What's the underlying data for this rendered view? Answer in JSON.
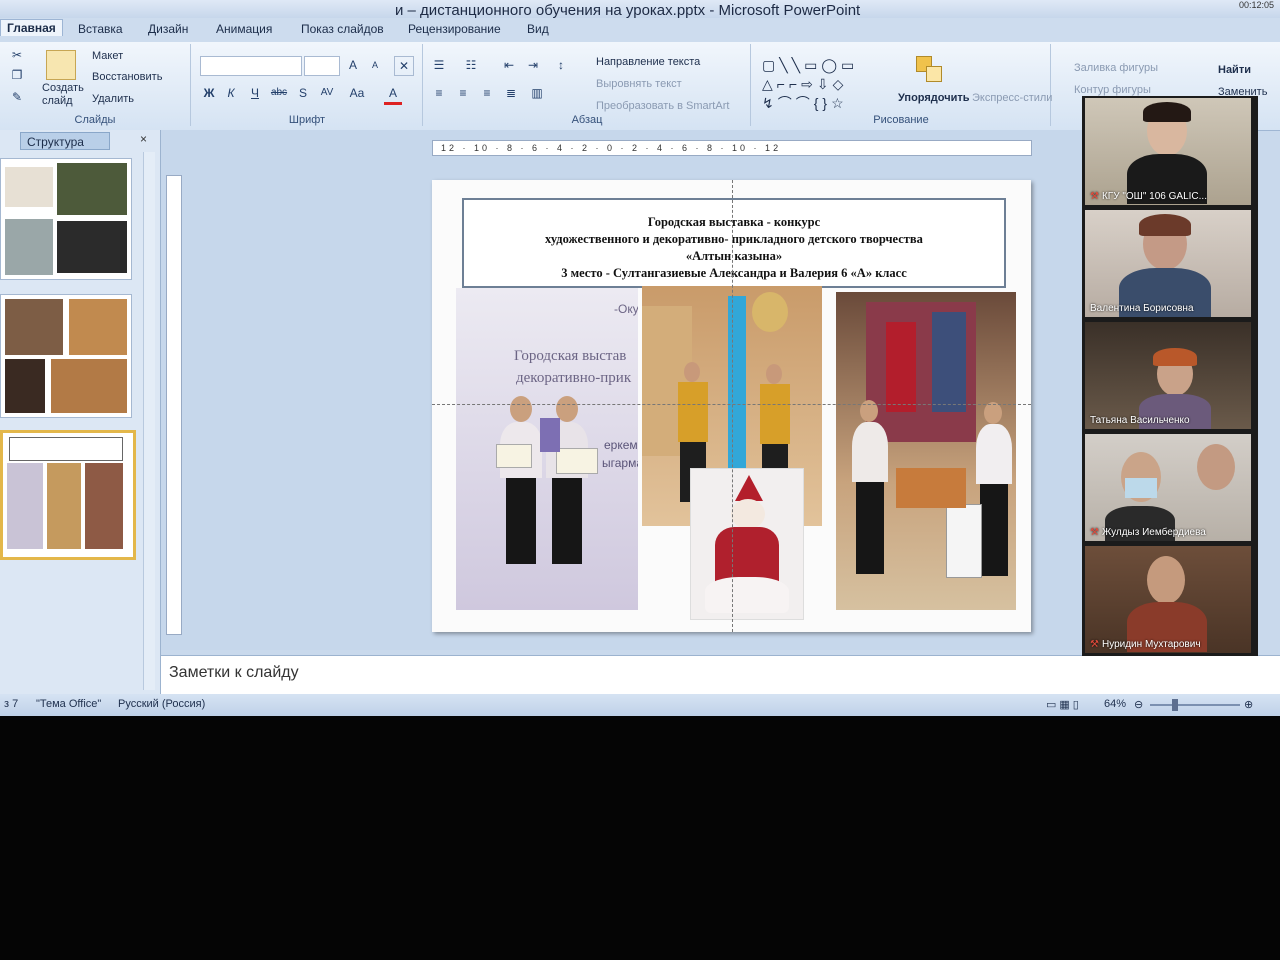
{
  "window": {
    "title": "и – дистанционного обучения на уроках.pptx - Microsoft PowerPoint",
    "clock": "00:12:05"
  },
  "tabs": [
    {
      "label": "Главная"
    },
    {
      "label": "Вставка"
    },
    {
      "label": "Дизайн"
    },
    {
      "label": "Анимация"
    },
    {
      "label": "Показ слайдов"
    },
    {
      "label": "Рецензирование"
    },
    {
      "label": "Вид"
    }
  ],
  "ribbon": {
    "slides_group": {
      "label": "Слайды",
      "create_slide": "Создать слайд",
      "layout": "Макет",
      "reset": "Восстановить",
      "delete": "Удалить"
    },
    "font_group": {
      "label": "Шрифт",
      "bold": "Ж",
      "italic": "К",
      "underline": "Ч",
      "strike": "abc",
      "shadow": "S",
      "spacing": "AV",
      "case": "Aa",
      "grow": "A",
      "shrink": "A",
      "color": "A"
    },
    "paragraph_group": {
      "label": "Абзац",
      "text_direction": "Направление текста",
      "align_text": "Выровнять текст",
      "smartart": "Преобразовать в SmartArt"
    },
    "drawing_group": {
      "label": "Рисование",
      "arrange": "Упорядочить",
      "quick_styles": "Экспресс-стили",
      "shape_fill": "Заливка фигуры",
      "shape_outline": "Контур фигуры"
    },
    "editing_group": {
      "find": "Найти",
      "replace": "Заменить"
    }
  },
  "left_pane": {
    "tab": "Структура",
    "close": "×"
  },
  "ruler": {
    "h_ticks": "12 · 10 · 8 · 6 · 4 · 2 · 0 · 2 · 4 · 6 · 8 · 10 · 12"
  },
  "slide": {
    "title_line1": "Городская   выставка - конкурс",
    "title_line2": "художественного и декоративно- прикладного   детского творчества",
    "title_line3": "«Алтын казына»",
    "title_line4": "3 место - Султангазиевые Александра и Валерия  6 «А» класс",
    "banner_text_1": "Городская выстав",
    "banner_text_2": "декоративно-прик",
    "banner_text_3": "-Оку",
    "banner_text_4": "ыгарма",
    "banner_text_5": "еркеме"
  },
  "notes": {
    "placeholder": "Заметки к слайду"
  },
  "status": {
    "slide_num": "з 7",
    "theme": "\"Тема Office\"",
    "language": "Русский (Россия)",
    "zoom": "64%"
  },
  "participants": [
    {
      "name": "КГУ \"ОШ\" 106 GALIC...",
      "muted": true
    },
    {
      "name": "Валентина Борисовна",
      "muted": false
    },
    {
      "name": "Татьяна Васильченко",
      "muted": false
    },
    {
      "name": "Жулдыз Иембердиева",
      "muted": true
    },
    {
      "name": "Нуридин Мухтарович",
      "muted": true
    }
  ],
  "colors": {
    "ribbon": "#dce8f6",
    "accent_selected": "#e3b74a",
    "mic_muted": "#e54b3c"
  }
}
